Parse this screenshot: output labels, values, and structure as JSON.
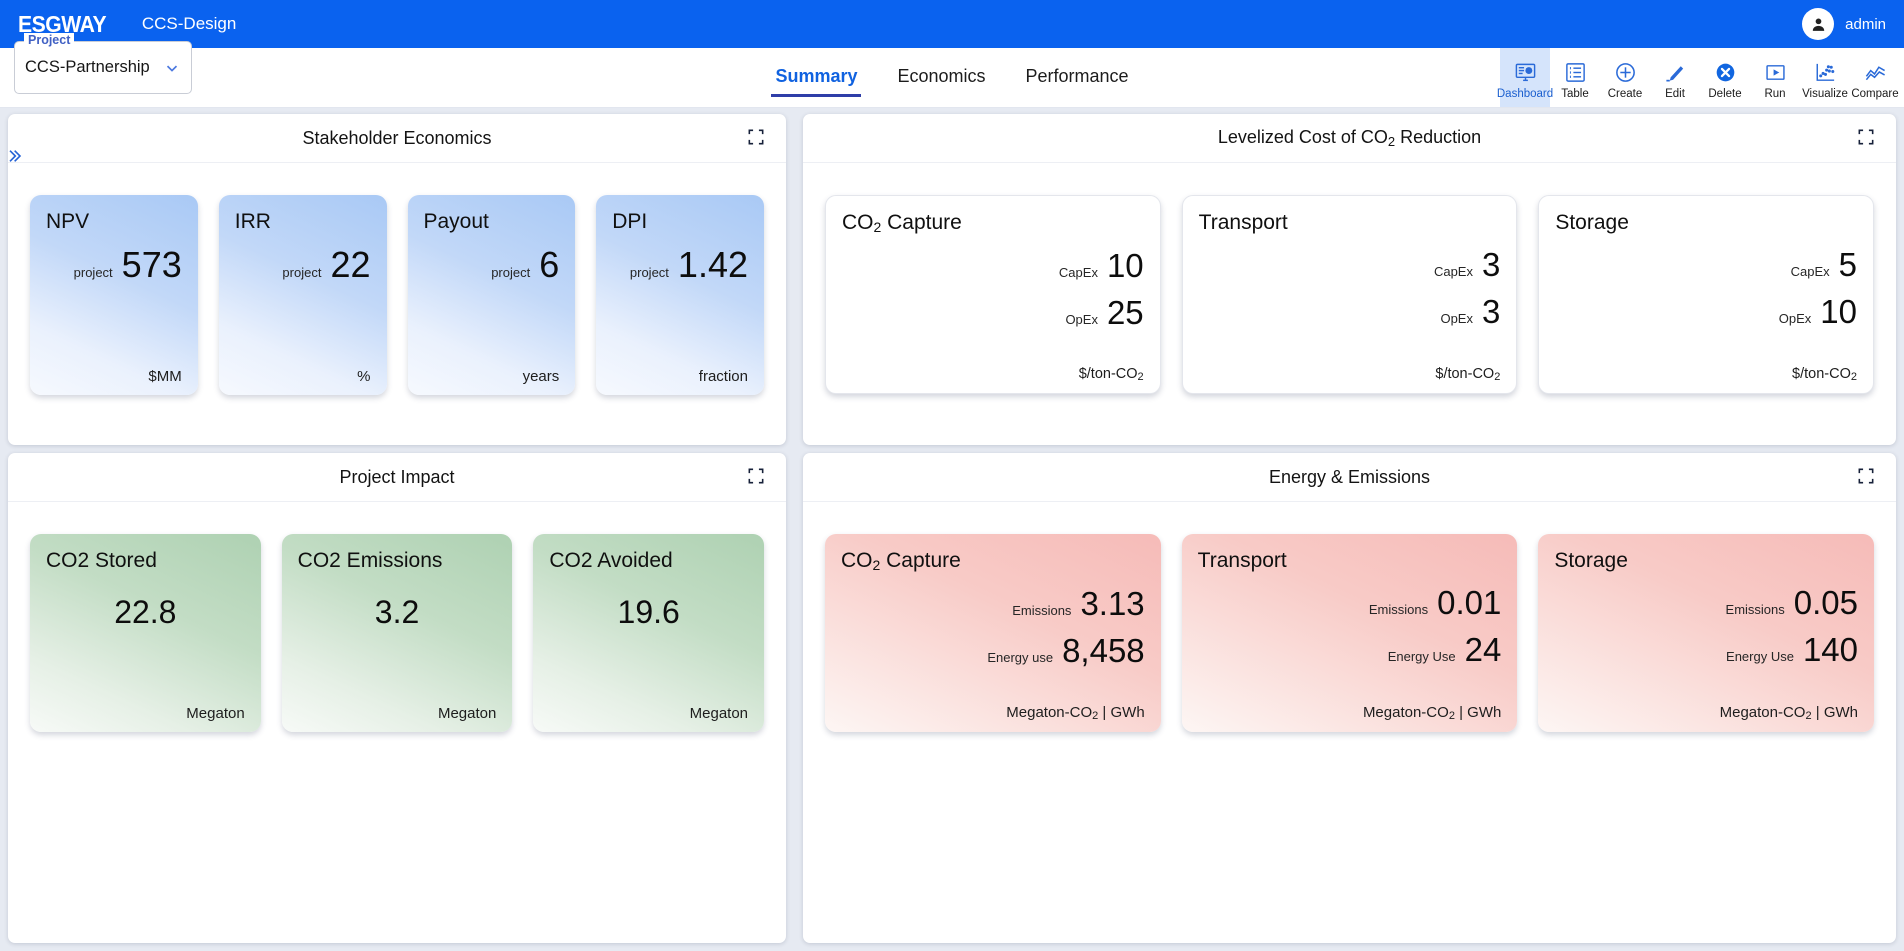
{
  "topbar": {
    "brand": "ESGWAY",
    "app_name": "CCS-Design",
    "user_name": "admin",
    "brand_bg": "#0a62ef"
  },
  "project_picker": {
    "label": "Project",
    "value": "CCS-Partnership"
  },
  "tabs": [
    {
      "label": "Summary",
      "active": true
    },
    {
      "label": "Economics",
      "active": false
    },
    {
      "label": "Performance",
      "active": false
    }
  ],
  "toolbar": [
    {
      "label": "Dashboard",
      "icon": "dashboard-icon",
      "active": true
    },
    {
      "label": "Table",
      "icon": "table-icon",
      "active": false
    },
    {
      "label": "Create",
      "icon": "plus-circle-icon",
      "active": false
    },
    {
      "label": "Edit",
      "icon": "pencil-icon",
      "active": false
    },
    {
      "label": "Delete",
      "icon": "delete-x-icon",
      "active": false
    },
    {
      "label": "Run",
      "icon": "play-icon",
      "active": false
    },
    {
      "label": "Visualize",
      "icon": "scatter-plot-icon",
      "active": false
    },
    {
      "label": "Compare",
      "icon": "line-chart-icon",
      "active": false
    }
  ],
  "panels": {
    "stakeholder": {
      "title": "Stakeholder Economics",
      "cards": [
        {
          "title": "NPV",
          "key": "project",
          "value": "573",
          "unit": "$MM"
        },
        {
          "title": "IRR",
          "key": "project",
          "value": "22",
          "unit": "%"
        },
        {
          "title": "Payout",
          "key": "project",
          "value": "6",
          "unit": "years"
        },
        {
          "title": "DPI",
          "key": "project",
          "value": "1.42",
          "unit": "fraction"
        }
      ]
    },
    "levelized": {
      "title_pre": "Levelized Cost of CO",
      "title_sub": "2",
      "title_post": " Reduction",
      "cards": [
        {
          "title_pre": "CO",
          "title_sub": "2",
          "title_post": " Capture",
          "row1_key": "CapEx",
          "row1_val": "10",
          "row2_key": "OpEx",
          "row2_val": "25",
          "unit_pre": "$/ton-CO",
          "unit_sub": "2",
          "unit_post": ""
        },
        {
          "title_pre": "Transport",
          "title_sub": "",
          "title_post": "",
          "row1_key": "CapEx",
          "row1_val": "3",
          "row2_key": "OpEx",
          "row2_val": "3",
          "unit_pre": "$/ton-CO",
          "unit_sub": "2",
          "unit_post": ""
        },
        {
          "title_pre": "Storage",
          "title_sub": "",
          "title_post": "",
          "row1_key": "CapEx",
          "row1_val": "5",
          "row2_key": "OpEx",
          "row2_val": "10",
          "unit_pre": "$/ton-CO",
          "unit_sub": "2",
          "unit_post": ""
        }
      ]
    },
    "impact": {
      "title": "Project Impact",
      "cards": [
        {
          "title": "CO2 Stored",
          "value": "22.8",
          "unit": "Megaton"
        },
        {
          "title": "CO2 Emissions",
          "value": "3.2",
          "unit": "Megaton"
        },
        {
          "title": "CO2 Avoided",
          "value": "19.6",
          "unit": "Megaton"
        }
      ]
    },
    "energy": {
      "title": "Energy & Emissions",
      "cards": [
        {
          "title_pre": "CO",
          "title_sub": "2",
          "title_post": " Capture",
          "row1_key": "Emissions",
          "row1_val": "3.13",
          "row2_key": "Energy use",
          "row2_val": "8,458",
          "unit_pre": "Megaton-CO",
          "unit_sub": "2",
          "unit_post": " | GWh"
        },
        {
          "title_pre": "Transport",
          "title_sub": "",
          "title_post": "",
          "row1_key": "Emissions",
          "row1_val": "0.01",
          "row2_key": "Energy Use",
          "row2_val": "24",
          "unit_pre": "Megaton-CO",
          "unit_sub": "2",
          "unit_post": " | GWh"
        },
        {
          "title_pre": "Storage",
          "title_sub": "",
          "title_post": "",
          "row1_key": "Emissions",
          "row1_val": "0.05",
          "row2_key": "Energy Use",
          "row2_val": "140",
          "unit_pre": "Megaton-CO",
          "unit_sub": "2",
          "unit_post": " | GWh"
        }
      ]
    }
  }
}
